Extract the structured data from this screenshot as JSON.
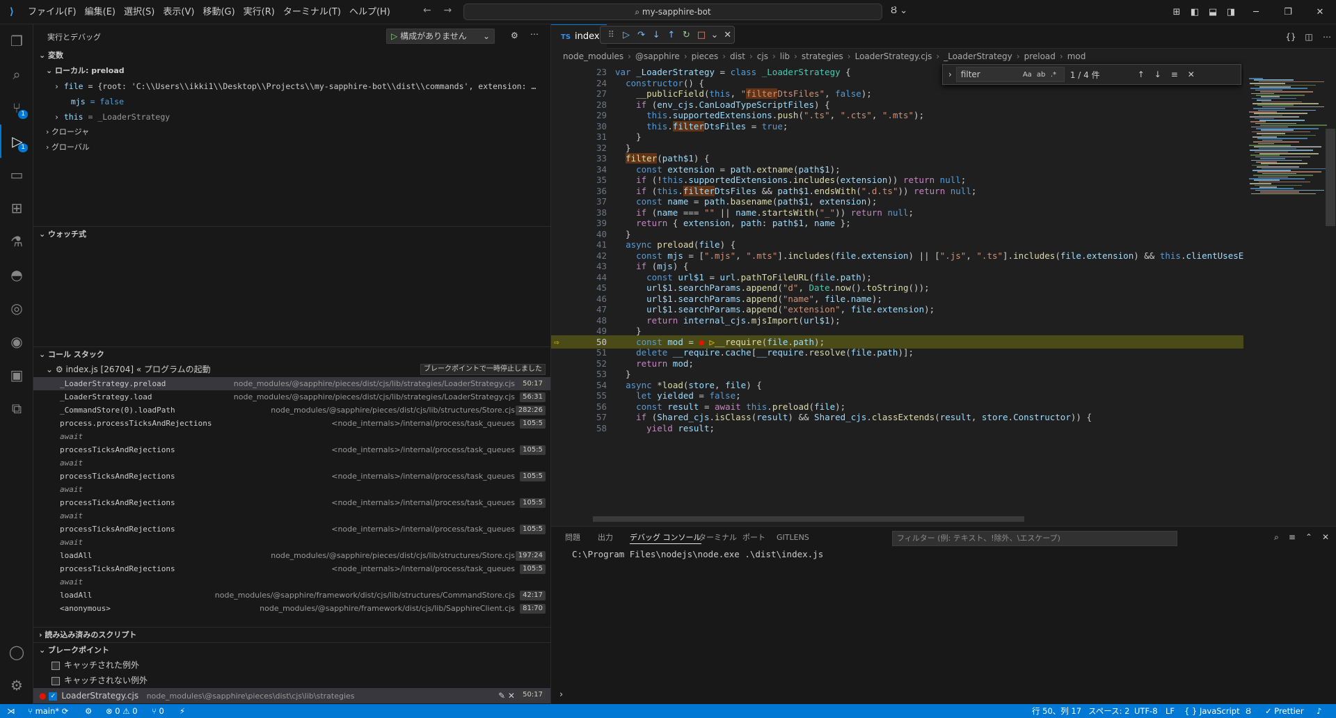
{
  "titlebar": {
    "menu": [
      "ファイル(F)",
      "編集(E)",
      "選択(S)",
      "表示(V)",
      "移動(G)",
      "実行(R)",
      "ターミナル(T)",
      "ヘルプ(H)"
    ],
    "search": "my-sapphire-bot",
    "nav_back": "←",
    "nav_forward": "→",
    "copilot": "Ȣ ⌄"
  },
  "sidebar": {
    "title": "実行とデバッグ",
    "run_config": "構成がありません",
    "variables_header": "変数",
    "local_scope": "ローカル: preload",
    "vars": [
      {
        "name": "file",
        "value": " = {root: 'C:\\\\Users\\\\ikki1\\\\Desktop\\\\Projects\\\\my-sapphire-bot\\\\dist\\\\commands', extension: …"
      },
      {
        "name": "mjs",
        "value": " = false"
      },
      {
        "name": "this",
        "value": " = _LoaderStrategy"
      }
    ],
    "closure": "クロージャ",
    "global": "グローバル",
    "watch_header": "ウォッチ式",
    "callstack_header": "コール スタック",
    "thread": "index.js [26704] « プログラムの起動",
    "paused_label": "ブレークポイントで一時停止しました",
    "frames": [
      {
        "name": "_LoaderStrategy.preload",
        "path": "node_modules/@sapphire/pieces/dist/cjs/lib/strategies/LoaderStrategy.cjs",
        "ln": "50:17"
      },
      {
        "name": "_LoaderStrategy.load",
        "path": "node_modules/@sapphire/pieces/dist/cjs/lib/strategies/LoaderStrategy.cjs",
        "ln": "56:31"
      },
      {
        "name": "_CommandStore(0).loadPath",
        "path": "node_modules/@sapphire/pieces/dist/cjs/lib/structures/Store.cjs",
        "ln": "282:26"
      },
      {
        "name": "process.processTicksAndRejections",
        "path": "<node_internals>/internal/process/task_queues",
        "ln": "105:5"
      },
      {
        "name": "await",
        "await": true
      },
      {
        "name": "processTicksAndRejections",
        "path": "<node_internals>/internal/process/task_queues",
        "ln": "105:5"
      },
      {
        "name": "await",
        "await": true
      },
      {
        "name": "processTicksAndRejections",
        "path": "<node_internals>/internal/process/task_queues",
        "ln": "105:5"
      },
      {
        "name": "await",
        "await": true
      },
      {
        "name": "processTicksAndRejections",
        "path": "<node_internals>/internal/process/task_queues",
        "ln": "105:5"
      },
      {
        "name": "await",
        "await": true
      },
      {
        "name": "processTicksAndRejections",
        "path": "<node_internals>/internal/process/task_queues",
        "ln": "105:5"
      },
      {
        "name": "await",
        "await": true
      },
      {
        "name": "loadAll",
        "path": "node_modules/@sapphire/pieces/dist/cjs/lib/structures/Store.cjs",
        "ln": "197:24"
      },
      {
        "name": "processTicksAndRejections",
        "path": "<node_internals>/internal/process/task_queues",
        "ln": "105:5"
      },
      {
        "name": "await",
        "await": true
      },
      {
        "name": "loadAll",
        "path": "node_modules/@sapphire/framework/dist/cjs/lib/structures/CommandStore.cjs",
        "ln": "42:17"
      },
      {
        "name": "<anonymous>",
        "path": "node_modules/@sapphire/framework/dist/cjs/lib/SapphireClient.cjs",
        "ln": "81:70"
      }
    ],
    "loaded_scripts": "読み込み済みのスクリプト",
    "breakpoints_header": "ブレークポイント",
    "bp_caught": "キャッチされた例外",
    "bp_uncaught": "キャッチされない例外",
    "bp_file": "LoaderStrategy.cjs",
    "bp_path": "node_modules\\@sapphire\\pieces\\dist\\cjs\\lib\\strategies",
    "bp_ln": "50:17"
  },
  "editor": {
    "tab_lang": "TS",
    "tab_label": "index.t",
    "breadcrumb": [
      "node_modules",
      "@sapphire",
      "pieces",
      "dist",
      "cjs",
      "lib",
      "strategies",
      "LoaderStrategy.cjs",
      "_LoaderStrategy",
      "preload",
      "mod"
    ],
    "find_value": "filter",
    "find_count": "1 / 4 件",
    "find_opts": [
      "Aa",
      "ab",
      ".*"
    ],
    "current_line": "50"
  },
  "panel": {
    "tabs": [
      "問題",
      "出力",
      "デバッグ コンソール",
      "ターミナル",
      "ポート",
      "GITLENS"
    ],
    "filter_placeholder": "フィルター (例: テキスト、!除外、\\エスケープ)",
    "console_output": "C:\\Program Files\\nodejs\\node.exe .\\dist\\index.js"
  },
  "status": {
    "branch": "main*",
    "errors": "⊗ 0 ⚠ 0",
    "ports": "⑂ 0",
    "position": "行 50、列 17",
    "spaces": "スペース: 2",
    "encoding": "UTF-8",
    "eol": "LF",
    "language": "{ } JavaScript",
    "prettier": "✓ Prettier"
  },
  "colors": {
    "accent": "#0078d4",
    "statusbar": "#0078d4",
    "breakpoint": "#e51400",
    "current_line": "#4b4b18"
  }
}
